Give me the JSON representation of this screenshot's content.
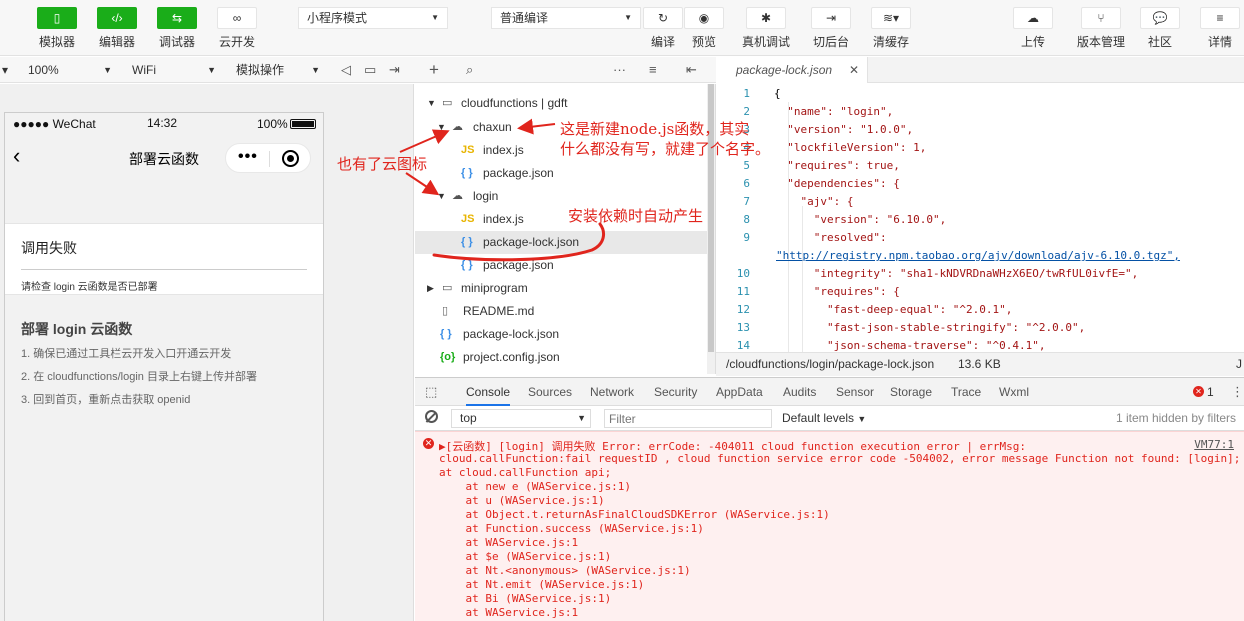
{
  "toolbar": {
    "simulator": "模拟器",
    "editor": "编辑器",
    "debugger": "调试器",
    "cloud": "云开发",
    "mode_select": "小程序模式",
    "compile_select": "普通编译",
    "compile": "编译",
    "preview": "预览",
    "remote_debug": "真机调试",
    "background": "切后台",
    "clear_cache": "清缓存",
    "upload": "上传",
    "version": "版本管理",
    "community": "社区",
    "details": "详情"
  },
  "sim_toolbar": {
    "zoom": "100%",
    "network": "WiFi",
    "operation": "模拟操作"
  },
  "phone": {
    "carrier": "●●●●● WeChat",
    "time": "14:32",
    "battery": "100%",
    "title": "部署云函数",
    "error_title": "调用失败",
    "error_msg": "请检查 login 云函数是否已部署",
    "guide_title": "部署 login 云函数",
    "steps": [
      "1. 确保已通过工具栏云开发入口开通云开发",
      "2. 在 cloudfunctions/login 目录上右键上传并部署",
      "3. 回到首页，重新点击获取 openid"
    ]
  },
  "tree": {
    "root": "cloudfunctions | gdft",
    "chaxun": "chaxun",
    "chaxun_index": "index.js",
    "chaxun_pkg": "package.json",
    "login": "login",
    "login_index": "index.js",
    "login_lock": "package-lock.json",
    "login_pkg": "package.json",
    "miniprogram": "miniprogram",
    "readme": "README.md",
    "root_lock": "package-lock.json",
    "project_config": "project.config.json"
  },
  "editor": {
    "tab": "package-lock.json",
    "line_numbers": [
      "1",
      "2",
      "3",
      "4",
      "5",
      "6",
      "7",
      "8",
      "9",
      "",
      "10",
      "11",
      "12",
      "13",
      "14"
    ],
    "lines": [
      "{",
      "  \"name\": \"login\",",
      "  \"version\": \"1.0.0\",",
      "  \"lockfileVersion\": 1,",
      "  \"requires\": true,",
      "  \"dependencies\": {",
      "    \"ajv\": {",
      "      \"version\": \"6.10.0\",",
      "      \"resolved\":",
      "\"http://registry.npm.taobao.org/ajv/download/ajv-6.10.0.tgz\",",
      "      \"integrity\": \"sha1-kNDVRDnaWHzX6EO/twRfUL0ivfE=\",",
      "      \"requires\": {",
      "        \"fast-deep-equal\": \"^2.0.1\",",
      "        \"fast-json-stable-stringify\": \"^2.0.0\",",
      "        \"json-schema-traverse\": \"^0.4.1\","
    ],
    "path": "/cloudfunctions/login/package-lock.json",
    "size": "13.6 KB",
    "lang": "J"
  },
  "console": {
    "tabs": [
      "Console",
      "Sources",
      "Network",
      "Security",
      "AppData",
      "Audits",
      "Sensor",
      "Storage",
      "Trace",
      "Wxml"
    ],
    "error_count": "1",
    "context": "top",
    "filter_placeholder": "Filter",
    "levels": "Default levels",
    "hidden": "1 item hidden by filters",
    "source": "VM77:1",
    "lines": [
      "▶[云函数] [login] 调用失败 Error: errCode: -404011 cloud function execution error | errMsg:",
      "cloud.callFunction:fail requestID , cloud function service error code -504002, error message Function not found: [login];",
      "at cloud.callFunction api;",
      "    at new e (WAService.js:1)",
      "    at u (WAService.js:1)",
      "    at Object.t.returnAsFinalCloudSDKError (WAService.js:1)",
      "    at Function.success (WAService.js:1)",
      "    at WAService.js:1",
      "    at $e (WAService.js:1)",
      "    at Nt.<anonymous> (WAService.js:1)",
      "    at Nt.emit (WAService.js:1)",
      "    at Bi (WAService.js:1)",
      "    at WAService.js:1"
    ]
  },
  "annotations": {
    "cloud_icon": "也有了云图标",
    "new_func_1": "这是新建node.js函数，其实",
    "new_func_2": "什么都没有写，就建了个名字。",
    "auto_gen": "安装依赖时自动产生"
  },
  "colors": {
    "accent_green": "#1aad19",
    "annotation_red": "#e0251d",
    "console_error_bg": "#fef0f0"
  }
}
